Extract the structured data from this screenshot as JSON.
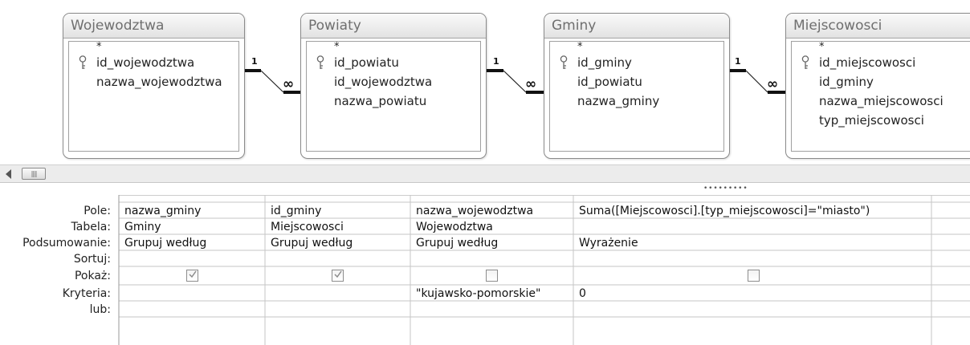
{
  "diagram": {
    "tables": [
      {
        "name": "Wojewodztwa",
        "fields": [
          "*",
          "id_wojewodztwa",
          "nazwa_wojewodztwa"
        ],
        "key_field": "id_wojewodztwa"
      },
      {
        "name": "Powiaty",
        "fields": [
          "*",
          "id_powiatu",
          "id_wojewodztwa",
          "nazwa_powiatu"
        ],
        "key_field": "id_powiatu"
      },
      {
        "name": "Gminy",
        "fields": [
          "*",
          "id_gminy",
          "id_powiatu",
          "nazwa_gminy"
        ],
        "key_field": "id_gminy"
      },
      {
        "name": "Miejscowosci",
        "fields": [
          "*",
          "id_miejscowosci",
          "id_gminy",
          "nazwa_miejscowosci",
          "typ_miejscowosci"
        ],
        "key_field": "id_miejscowosci"
      }
    ],
    "relationships": [
      {
        "from": "Wojewodztwa",
        "to": "Powiaty",
        "one_label": "1",
        "many_label": "∞"
      },
      {
        "from": "Powiaty",
        "to": "Gminy",
        "one_label": "1",
        "many_label": "∞"
      },
      {
        "from": "Gminy",
        "to": "Miejscowosci",
        "one_label": "1",
        "many_label": "∞"
      }
    ]
  },
  "grid": {
    "row_labels": [
      "Pole:",
      "Tabela:",
      "Podsumowanie:",
      "Sortuj:",
      "Pokaż:",
      "Kryteria:",
      "lub:"
    ],
    "columns": [
      {
        "pole": "nazwa_gminy",
        "tabela": "Gminy",
        "podsumowanie": "Grupuj według",
        "sortuj": "",
        "pokaz": true,
        "kryteria": "",
        "lub": ""
      },
      {
        "pole": "id_gminy",
        "tabela": "Miejscowosci",
        "podsumowanie": "Grupuj według",
        "sortuj": "",
        "pokaz": true,
        "kryteria": "",
        "lub": ""
      },
      {
        "pole": "nazwa_wojewodztwa",
        "tabela": "Wojewodztwa",
        "podsumowanie": "Grupuj według",
        "sortuj": "",
        "pokaz": false,
        "kryteria": "\"kujawsko-pomorskie\"",
        "lub": ""
      },
      {
        "pole": "Suma([Miejscowosci].[typ_miejscowosci]=\"miasto\")",
        "tabela": "",
        "podsumowanie": "Wyrażenie",
        "sortuj": "",
        "pokaz": false,
        "kryteria": "0",
        "lub": ""
      },
      {
        "pole": "",
        "tabela": "",
        "podsumowanie": "",
        "sortuj": "",
        "pokaz": null,
        "kryteria": "",
        "lub": ""
      }
    ]
  }
}
